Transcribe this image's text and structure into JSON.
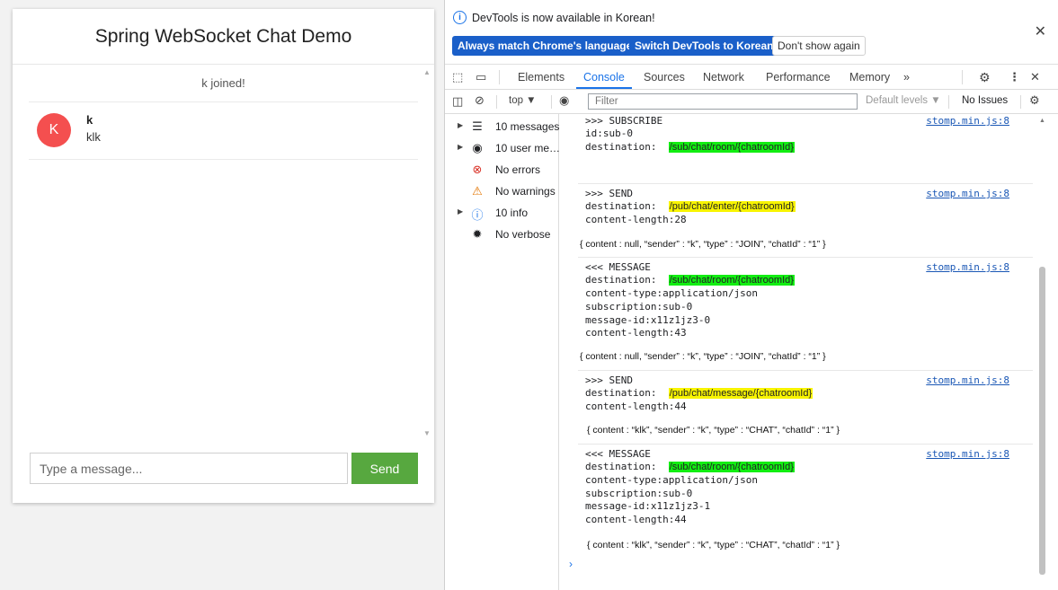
{
  "chat": {
    "title": "Spring WebSocket Chat Demo",
    "event_text": "k joined!",
    "message": {
      "avatar_letter": "K",
      "sender": "k",
      "text": "klk",
      "avatar_color": "#f44f4f"
    },
    "input_placeholder": "Type a message...",
    "send_label": "Send",
    "send_color": "#57a83f"
  },
  "devtools": {
    "infobar": {
      "text": "DevTools is now available in Korean!",
      "buttons": [
        "Always match Chrome's language",
        "Switch DevTools to Korean",
        "Don't show again"
      ]
    },
    "tabs": [
      "Elements",
      "Console",
      "Sources",
      "Network",
      "Performance",
      "Memory"
    ],
    "active_tab": "Console",
    "more_tabs": "»",
    "context": "top ▼",
    "filter_placeholder": "Filter",
    "levels": "Default levels ▼",
    "issues": "No Issues",
    "sidebar": [
      {
        "label": "10 messages",
        "icon": "list-icon",
        "glyph": "☰",
        "expandable": true
      },
      {
        "label": "10 user me…",
        "icon": "user-icon",
        "glyph": "◉",
        "expandable": true
      },
      {
        "label": "No errors",
        "icon": "error-icon",
        "glyph": "⊗",
        "expandable": false
      },
      {
        "label": "No warnings",
        "icon": "warning-icon",
        "glyph": "⚠",
        "expandable": false
      },
      {
        "label": "10 info",
        "icon": "info-icon",
        "glyph": "ⓘ",
        "expandable": true
      },
      {
        "label": "No verbose",
        "icon": "bug-icon",
        "glyph": "✹",
        "expandable": false
      }
    ],
    "source_link": "stomp.min.js:8",
    "logs": [
      {
        "lines": [
          ">>> SUBSCRIBE",
          "id:sub-0"
        ],
        "dest_label": "destination:",
        "dest": "/sub/chat/room/{chatroomId}",
        "dest_color": "green",
        "after": []
      },
      {
        "lines": [
          ">>> SEND"
        ],
        "dest_label": "destination:",
        "dest": "/pub/chat/enter/{chatroomId}",
        "dest_color": "yellow",
        "after": [
          "content-length:28"
        ],
        "json": "{ content : null, “sender” : “k”, “type” : “JOIN”, “chatId” : “1” }"
      },
      {
        "lines": [
          "<<< MESSAGE"
        ],
        "dest_label": "destination:",
        "dest": "/sub/chat/room/{chatroomId}",
        "dest_color": "green",
        "after": [
          "content-type:application/json",
          "subscription:sub-0",
          "message-id:x11z1jz3-0",
          "content-length:43"
        ],
        "json": "{ content : null, “sender” : “k”, “type” : “JOIN”, “chatId” : “1” }"
      },
      {
        "lines": [
          ">>> SEND"
        ],
        "dest_label": "destination:",
        "dest": "/pub/chat/message/{chatroomId}",
        "dest_color": "yellow",
        "after": [
          "content-length:44"
        ],
        "json": "{ content : “klk”, “sender” : “k”, “type” : “CHAT”, “chatId” : “1” }"
      },
      {
        "lines": [
          "<<< MESSAGE"
        ],
        "dest_label": "destination:",
        "dest": "/sub/chat/room/{chatroomId}",
        "dest_color": "green",
        "after": [
          "content-type:application/json",
          "subscription:sub-0",
          "message-id:x11z1jz3-1",
          "content-length:44"
        ],
        "json": "{ content : “klk”, “sender” : “k”, “type” : “CHAT”, “chatId” : “1” }"
      }
    ],
    "prompt": "›"
  }
}
